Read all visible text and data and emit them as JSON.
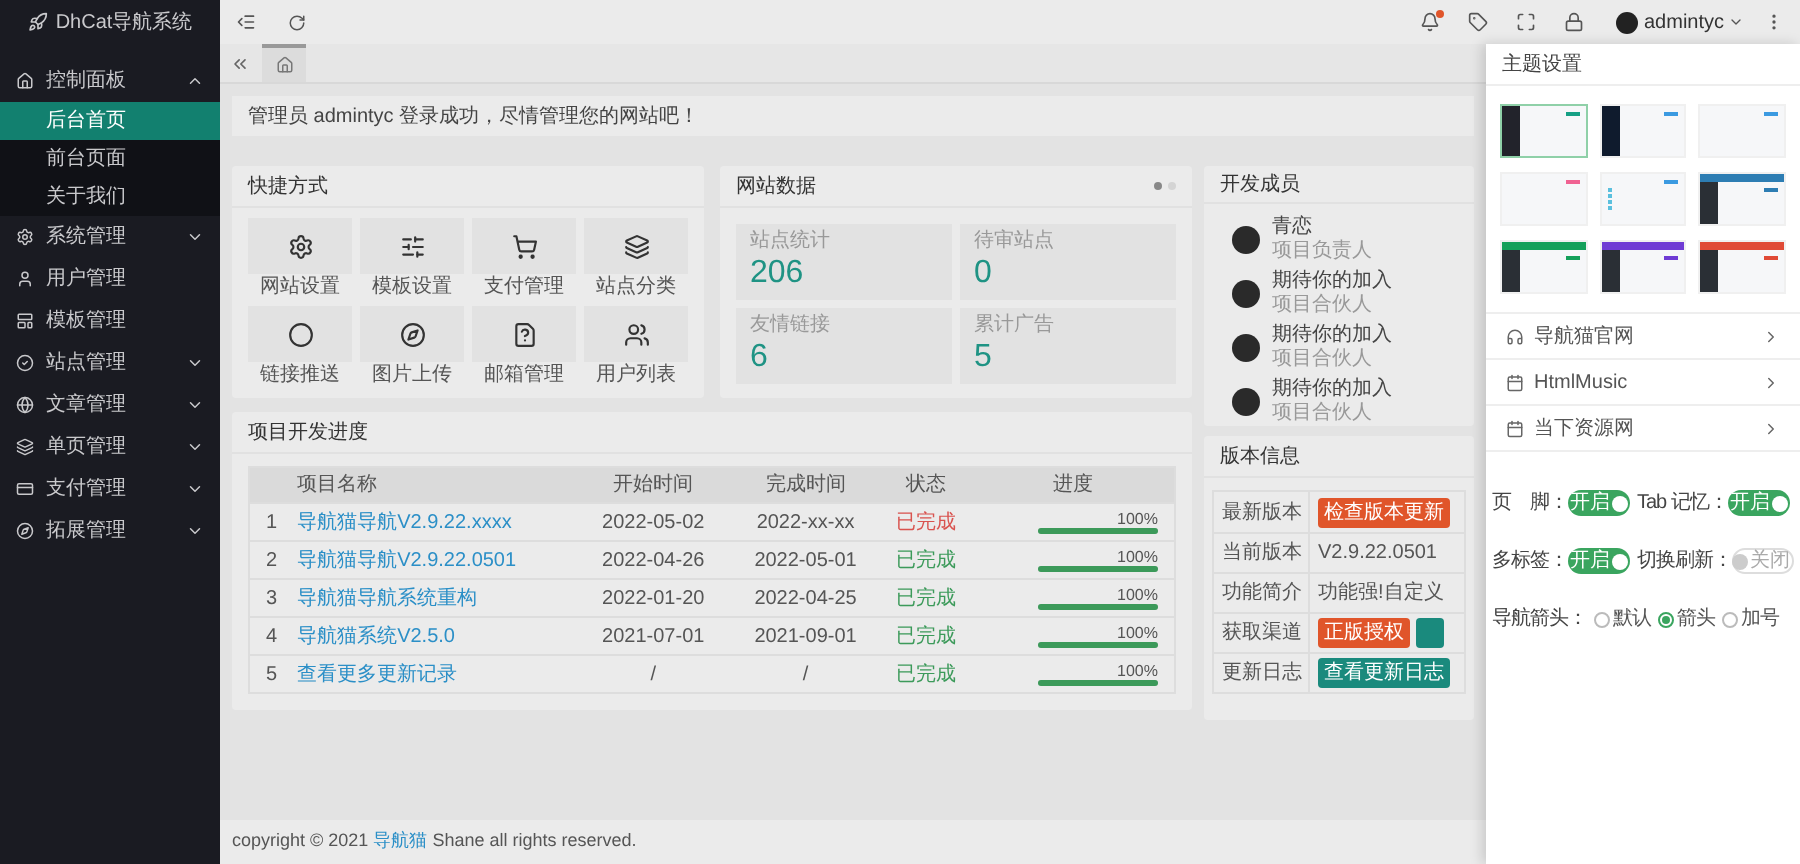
{
  "sidebar": {
    "logo": "DhCat导航系统",
    "items": [
      {
        "label": "控制面板",
        "expandable": true,
        "expanded": true,
        "children": [
          {
            "label": "后台首页",
            "selected": true
          },
          {
            "label": "前台页面",
            "selected": false
          },
          {
            "label": "关于我们",
            "selected": false
          }
        ]
      },
      {
        "label": "系统管理",
        "expandable": true,
        "expanded": false
      },
      {
        "label": "用户管理",
        "expandable": false
      },
      {
        "label": "模板管理",
        "expandable": false
      },
      {
        "label": "站点管理",
        "expandable": true,
        "expanded": false
      },
      {
        "label": "文章管理",
        "expandable": true,
        "expanded": false
      },
      {
        "label": "单页管理",
        "expandable": true,
        "expanded": false
      },
      {
        "label": "支付管理",
        "expandable": true,
        "expanded": false
      },
      {
        "label": "拓展管理",
        "expandable": true,
        "expanded": false
      }
    ]
  },
  "header": {
    "user": "admintyc",
    "notification_dot": true
  },
  "notice": "管理员 admintyc 登录成功，尽情管理您的网站吧！",
  "quick": {
    "title": "快捷方式",
    "items": [
      {
        "label": "网站设置"
      },
      {
        "label": "模板设置"
      },
      {
        "label": "支付管理"
      },
      {
        "label": "站点分类"
      },
      {
        "label": "链接推送"
      },
      {
        "label": "图片上传"
      },
      {
        "label": "邮箱管理"
      },
      {
        "label": "用户列表"
      }
    ]
  },
  "site_data": {
    "title": "网站数据",
    "dots": [
      {
        "selected": true
      },
      {
        "selected": false
      }
    ],
    "stats": [
      {
        "label": "站点统计",
        "value": "206"
      },
      {
        "label": "待审站点",
        "value": "0"
      },
      {
        "label": "友情链接",
        "value": "6"
      },
      {
        "label": "累计广告",
        "value": "5"
      }
    ]
  },
  "members": {
    "title": "开发成员",
    "items": [
      {
        "name": "青恋",
        "role": "项目负责人"
      },
      {
        "name": "期待你的加入",
        "role": "项目合伙人"
      },
      {
        "name": "期待你的加入",
        "role": "项目合伙人"
      },
      {
        "name": "期待你的加入",
        "role": "项目合伙人"
      }
    ]
  },
  "progress": {
    "title": "项目开发进度",
    "columns": [
      "项目名称",
      "开始时间",
      "完成时间",
      "状态",
      "进度"
    ],
    "rows": [
      {
        "index": "1",
        "name": "导航猫导航V2.9.22.xxxx",
        "start": "2022-05-02",
        "end": "2022-xx-xx",
        "status": "已完成",
        "color": "#d9534f",
        "level": 1,
        "percent": "100%"
      },
      {
        "index": "2",
        "name": "导航猫导航V2.9.22.0501",
        "start": "2022-04-26",
        "end": "2022-05-01",
        "status": "已完成",
        "color": "#3c9a5a",
        "level": 1,
        "percent": "100%"
      },
      {
        "index": "3",
        "name": "导航猫导航系统重构",
        "start": "2022-01-20",
        "end": "2022-04-25",
        "status": "已完成",
        "color": "#3c9a5a",
        "level": 1,
        "percent": "100%"
      },
      {
        "index": "4",
        "name": "导航猫系统V2.5.0",
        "start": "2021-07-01",
        "end": "2021-09-01",
        "status": "已完成",
        "color": "#3c9a5a",
        "level": 1,
        "percent": "100%"
      },
      {
        "index": "5",
        "name": "查看更多更新记录",
        "start": "/",
        "end": "/",
        "status": "已完成",
        "color": "#3c9a5a",
        "level": 1,
        "percent": "100%"
      }
    ]
  },
  "version": {
    "title": "版本信息",
    "rows": [
      {
        "label": "最新版本",
        "kind": "buttons",
        "buttons": [
          {
            "label": "检查版本更新",
            "color": "#e0552a"
          }
        ]
      },
      {
        "label": "当前版本",
        "kind": "text",
        "value": "V2.9.22.0501"
      },
      {
        "label": "功能简介",
        "kind": "text",
        "value": "功能强!自定义"
      },
      {
        "label": "获取渠道",
        "kind": "buttons",
        "buttons": [
          {
            "label": "正版授权",
            "color": "#e0552a"
          },
          {
            "color": "#1a8a7d"
          }
        ]
      },
      {
        "label": "更新日志",
        "kind": "buttons",
        "buttons": [
          {
            "label": "查看更新日志",
            "color": "#1a8a7d"
          }
        ]
      }
    ]
  },
  "footer": {
    "before": "copyright © 2021 ",
    "link": "导航猫",
    "after": " Shane all rights reserved."
  },
  "theme_panel": {
    "title": "主题设置",
    "themes": [
      {
        "kind": "dark",
        "color": "#16a085",
        "selected": true
      },
      {
        "kind": "navy",
        "color": "#3b9ae1",
        "selected": false
      },
      {
        "kind": "light",
        "color": "#3b9ae1",
        "selected": false
      },
      {
        "kind": "light",
        "color": "#f06292",
        "selected": false
      },
      {
        "kind": "dots",
        "color": "#3b9ae1",
        "selected": false
      },
      {
        "kind": "topbar",
        "color": "#2d7db3",
        "selected": false
      },
      {
        "kind": "topbar",
        "color": "#14a05a",
        "selected": false
      },
      {
        "kind": "topbar",
        "color": "#6f3bd4",
        "selected": false
      },
      {
        "kind": "topbar",
        "color": "#e04a36",
        "selected": false
      }
    ],
    "links": [
      {
        "label": "导航猫官网"
      },
      {
        "label": "HtmlMusic"
      },
      {
        "label": "当下资源网"
      }
    ],
    "switches": [
      {
        "label": "页　脚：",
        "text": "开启",
        "on": true
      },
      {
        "label": "Tab 记忆：",
        "text": "开启",
        "on": true
      },
      {
        "label": "多标签：",
        "text": "开启",
        "on": true
      },
      {
        "label": "切换刷新：",
        "text": "关闭",
        "on": false
      }
    ],
    "radio": {
      "label": "导航箭头：",
      "options": [
        {
          "label": "默认",
          "selected": false
        },
        {
          "label": "箭头",
          "selected": true
        },
        {
          "label": "加号",
          "selected": false
        }
      ]
    }
  }
}
